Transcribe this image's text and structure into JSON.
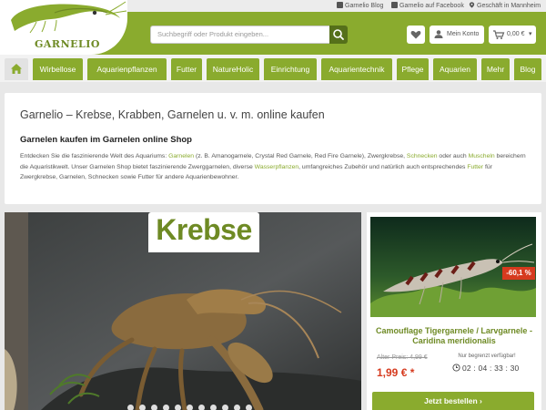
{
  "topbar": {
    "blog": "Garnelio Blog",
    "facebook": "Garnelio auf Facebook",
    "store": "Geschäft in Mannheim"
  },
  "logo": {
    "text": "GARNELIO"
  },
  "search": {
    "placeholder": "Suchbegriff oder Produkt eingeben..."
  },
  "account": {
    "label": "Mein Konto"
  },
  "cart": {
    "total": "0,00 €"
  },
  "nav": {
    "tabs": [
      "Wirbellose",
      "Aquarienpflanzen",
      "Futter",
      "NatureHolic",
      "Einrichtung",
      "Aquarientechnik",
      "Pflege",
      "Aquarien",
      "Mehr",
      "Blog"
    ]
  },
  "intro": {
    "title": "Garnelio – Krebse, Krabben, Garnelen u. v. m. online kaufen",
    "subtitle": "Garnelen kaufen im Garnelen online Shop",
    "p1": "Entdecken Sie die faszinierende Welt des Aquariums: ",
    "l1": "Garnelen",
    "p2": " (z. B. Amanogarnele, Crystal Red Garnele, Red Fire Garnele), Zwergkrebse, ",
    "l2": "Schnecken",
    "p3": " oder auch ",
    "l3": "Muscheln",
    "p4": " bereichern die Aquaristikwelt. Unser Garnelen Shop bietet faszinierende Zwerggarnelen, diverse ",
    "l4": "Wasserpflanzen",
    "p5": ", umfangreiches Zubehör und natürlich auch entsprechendes ",
    "l5": "Futter",
    "p6": " für Zwergkrebse, Garnelen, Schnecken sowie Futter für andere Aquarienbewohner."
  },
  "hero": {
    "label": "Krebse"
  },
  "product": {
    "badge": "-60,1 %",
    "title": "Camouflage Tigergarnele / Larvgarnele - Caridina meridionalis",
    "old_price": "Alter Preis: 4,99 €",
    "price": "1,99 € *",
    "availability": "Nur begrenzt verfügbar!",
    "timer": "02 : 04 : 33 : 30",
    "buy_label": "Jetzt bestellen"
  },
  "colors": {
    "brand_green": "#8aab2e",
    "dark_green": "#55701a",
    "sale_red": "#d63a1e"
  }
}
